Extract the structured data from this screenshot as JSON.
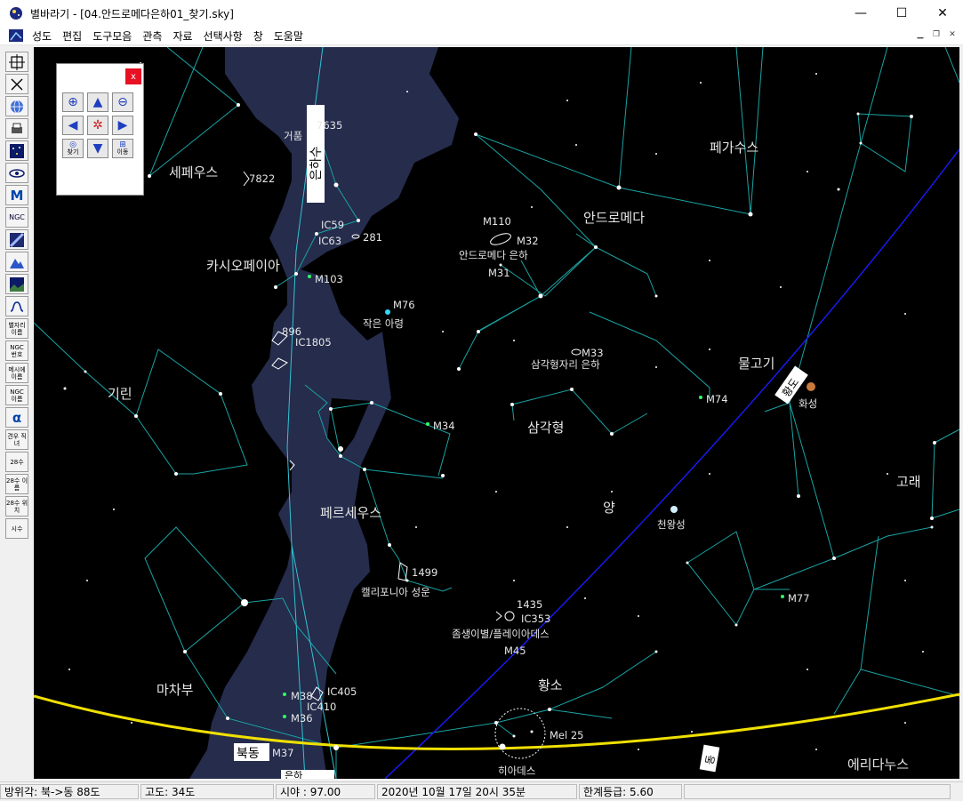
{
  "window": {
    "title": "별바라기 - [04.안드로메다은하01_찾기.sky]",
    "minimize": "—",
    "maximize": "☐",
    "close": "✕"
  },
  "menu": [
    "성도",
    "편집",
    "도구모음",
    "관측",
    "자료",
    "선택사항",
    "창",
    "도움말"
  ],
  "toolbar": {
    "t_ngc": "NGC",
    "t_star_name": "별자리 이름",
    "t_ngc_num": "NGC 번호",
    "t_messier_name": "메시에 이름",
    "t_ngc_name": "NGC 이름",
    "t_alpha": "α",
    "t_gyeonu": "견우 직녀",
    "t_28su": "28수",
    "t_28_name": "28수 이름",
    "t_28_pos": "28수 위치",
    "t_sisu": "시수",
    "t_m": "M"
  },
  "finder_panel": {
    "close": "x",
    "find_label": "찾기",
    "move_label": "이동"
  },
  "constellations": {
    "cepheus": "세페우스",
    "cassiopeia": "카시오페이아",
    "camelopardalis": "기린",
    "perseus": "페르세우스",
    "auriga": "마차부",
    "andromeda": "안드로메다",
    "pegasus": "페가수스",
    "pisces": "물고기",
    "triangulum": "삼각형",
    "aries": "양",
    "cetus": "고래",
    "taurus": "황소",
    "eridanus": "에리다누스"
  },
  "objects": {
    "bubble": "거품",
    "bubble_num": "7635",
    "n7822": "7822",
    "ic59": "IC59",
    "ic63": "IC63",
    "n281": "281",
    "m110": "M110",
    "m32": "M32",
    "andromeda_galaxy": "안드로메다 은하",
    "m31": "M31",
    "m103": "M103",
    "m76": "M76",
    "little_dumbbell": "작은 아령",
    "n896": "896",
    "ic1805": "IC1805",
    "m33": "M33",
    "triangulum_galaxy": "삼각형자리 은하",
    "m74": "M74",
    "m34": "M34",
    "uranus": "천왕성",
    "mars": "화성",
    "n1499": "1499",
    "california": "캘리포니아 성운",
    "n1435": "1435",
    "ic353": "IC353",
    "pleiades": "좀생이별/플레이아데스",
    "m45": "M45",
    "m77": "M77",
    "m38": "M38",
    "ic405": "IC405",
    "ic410": "IC410",
    "m36": "M36",
    "m37": "M37",
    "mel25": "Mel 25",
    "hyades": "히아데스"
  },
  "sky_labels": {
    "milky_way": "은하수",
    "ecliptic_east": "동",
    "horizon_northeast": "북동",
    "horizon_bottom": "은하",
    "ecliptic_label": "황도"
  },
  "status": {
    "azimuth": "방위각: 북->동  88도",
    "altitude": "고도:   34도",
    "fov": "시야 : 97.00",
    "datetime": "2020년 10월 17일 20시 35분",
    "limit_mag": "한계등급:  5.60"
  },
  "colors": {
    "sky": "#000000",
    "milky_way": "#252c4c",
    "constellation_line": "#1aa3a3",
    "horizon": "#f0e000",
    "ecliptic": "#1a1aff"
  }
}
